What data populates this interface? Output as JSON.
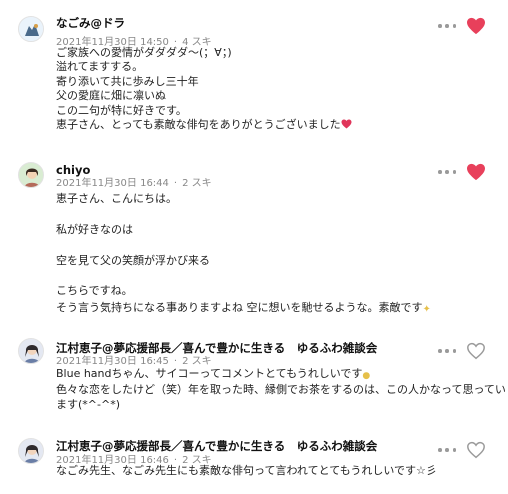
{
  "comments": [
    {
      "author": "なごみ@ドラ",
      "date": "2021年11月30日 14:50",
      "likes": "4 スキ",
      "liked": true,
      "lines": [
        "ご家族への愛情がダダダダ～(；∀；)",
        "溢れてますする。",
        "寄り添いて共に歩みし三十年",
        "父の愛庭に畑に凛いぬ",
        "この二句が特に好きです。",
        "恵子さん、とっても素敵な俳句をありがとうございました"
      ]
    },
    {
      "author": "chiyo",
      "date": "2021年11月30日 16:44",
      "likes": "2 スキ",
      "liked": true,
      "lines": [
        "恵子さん、こんにちは。",
        "",
        "私が好きなのは",
        "",
        "空を見て父の笑顔が浮かび来る",
        "",
        "こちらですね。",
        "そう言う気持ちになる事ありますよね 空に想いを馳せるような。素敵です"
      ]
    },
    {
      "author": "江村恵子@夢応援部長／喜んで豊かに生きる　ゆるふわ雑談会",
      "date": "2021年11月30日 16:45",
      "likes": "2 スキ",
      "liked": false,
      "lines": [
        "Blue handちゃん、サイコーってコメントとてもうれしいです",
        "色々な恋をしたけど（笑）年を取った時、縁側でお茶をするのは、この人かなって思ってい",
        "ます(*^-^*)"
      ]
    },
    {
      "author": "江村恵子@夢応援部長／喜んで豊かに生きる　ゆるふわ雑談会",
      "date": "2021年11月30日 16:46",
      "likes": "2 スキ",
      "liked": false,
      "lines": [
        "なごみ先生、なごみ先生にも素敵な俳句って言われてとてもうれしいです☆彡"
      ]
    }
  ],
  "colors": {
    "heart_liked": "#e8405b",
    "heart_outline": "#9a9a9a",
    "meta_text": "#888888",
    "avatar1_bg": "#eaf3fb",
    "avatar2_bg": "#d9ecd2",
    "avatar3_bg": "#e4e8f2"
  },
  "icons": [
    "user-avatar-icon",
    "more-options-icon",
    "heart-icon"
  ]
}
